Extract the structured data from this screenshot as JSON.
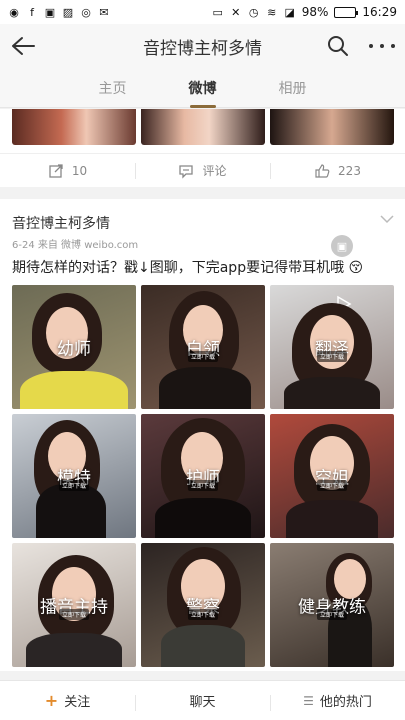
{
  "status": {
    "battery": "98%",
    "time": "16:29",
    "battery_fraction": 0.98
  },
  "header": {
    "title": "音控博主柯多情"
  },
  "tabs": [
    {
      "label": "主页",
      "active": false
    },
    {
      "label": "微博",
      "active": true
    },
    {
      "label": "相册",
      "active": false
    }
  ],
  "prev_post_actions": {
    "repost_count": "10",
    "comment_label": "评论",
    "like_count": "223"
  },
  "post": {
    "author": "音控博主柯多情",
    "meta": "6-24  来自 微博 weibo.com",
    "text": "期待怎样的对话？戳↓图聊，下完app要记得带耳机哦",
    "images": [
      {
        "caption": "幼师",
        "tag": ""
      },
      {
        "caption": "白领",
        "tag": "立即下载"
      },
      {
        "caption": "翻泽",
        "tag": "立即下载"
      },
      {
        "caption": "模特",
        "tag": "立即下载"
      },
      {
        "caption": "护师",
        "tag": "立即下载"
      },
      {
        "caption": "空姐",
        "tag": "立即下载"
      },
      {
        "caption": "播音主持",
        "tag": "立即下载"
      },
      {
        "caption": "警察",
        "tag": "立即下载"
      },
      {
        "caption": "健身教练",
        "tag": "立即下载"
      }
    ]
  },
  "bottom_bar": {
    "follow": "关注",
    "chat": "聊天",
    "hot": "他的热门"
  },
  "colors": {
    "accent": "#8b6b3a",
    "follow_plus": "#e38b2c"
  }
}
